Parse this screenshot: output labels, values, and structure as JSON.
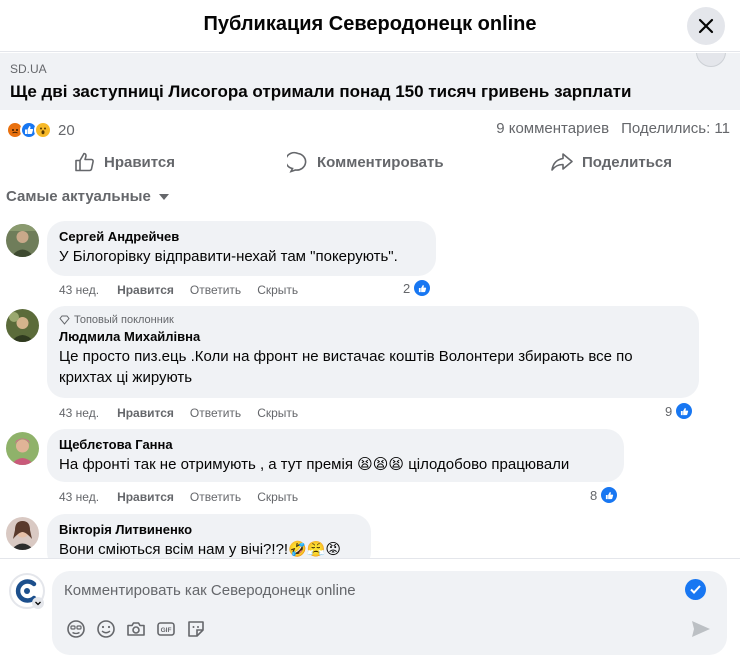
{
  "header": {
    "title": "Публикация Северодонецк online"
  },
  "link": {
    "domain": "SD.UA",
    "title": "Ще дві заступниці Лисогора отримали понад 150 тисяч гривень зарплати"
  },
  "stats": {
    "reaction_count": "20",
    "comments": "9 комментариев",
    "shares": "Поделились: 11"
  },
  "actions": {
    "like": "Нравится",
    "comment": "Комментировать",
    "share": "Поделиться"
  },
  "sort": {
    "label": "Самые актуальные"
  },
  "comments": [
    {
      "author": "Сергей Андрейчев",
      "badge": "",
      "text": "У Білогорівку відправити-нехай там \"покерують\".",
      "time": "43 нед.",
      "like": "Нравится",
      "reply": "Ответить",
      "hide": "Скрыть",
      "likes": "2"
    },
    {
      "author": "Людмила Михайлівна",
      "badge": "Топовый поклонник",
      "text": "Це просто пиз.ець .Коли на фронт не вистачає коштів Волонтери збирають все по крихтах ці жирують",
      "time": "43 нед.",
      "like": "Нравится",
      "reply": "Ответить",
      "hide": "Скрыть",
      "likes": "9"
    },
    {
      "author": "Щеблєтова Ганна",
      "badge": "",
      "text": "На фронті так не отримують , а тут премія 😫😫😫 цілодобово працювали",
      "time": "43 нед.",
      "like": "Нравится",
      "reply": "Ответить",
      "hide": "Скрыть",
      "likes": "8"
    },
    {
      "author": "Вікторія Литвиненко",
      "badge": "",
      "text": "Вони сміються всім нам у вічі?!?!🤣😤😡",
      "time": "",
      "like": "",
      "reply": "",
      "hide": "",
      "likes": ""
    }
  ],
  "composer": {
    "placeholder": "Комментировать как Северодонецк online"
  },
  "colors": {
    "accent": "#1877f2",
    "bubble": "#f0f2f5",
    "muted": "#65676b"
  },
  "icons": [
    "close-icon",
    "like-icon",
    "comment-icon",
    "share-icon",
    "diamond-icon",
    "avatar-icon",
    "sticker-icon",
    "emoji-icon",
    "camera-icon",
    "gif-icon",
    "send-icon"
  ]
}
